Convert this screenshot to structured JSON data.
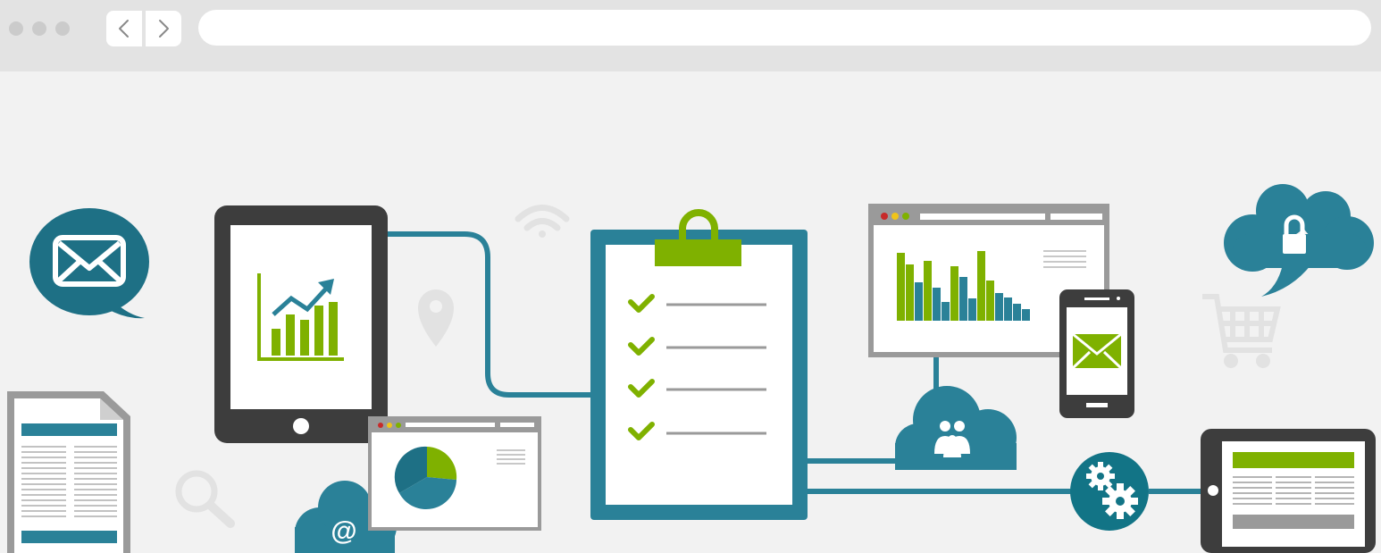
{
  "browser": {
    "url": "",
    "back_icon": "chevron-left-icon",
    "forward_icon": "chevron-right-icon"
  },
  "illustration": {
    "icons": [
      "mail-speech-bubble-icon",
      "newspaper-document-icon",
      "tablet-growth-chart-icon",
      "search-icon",
      "wifi-icon",
      "location-pin-icon",
      "at-sign-cloud-icon",
      "pie-chart-window-icon",
      "checklist-clipboard-icon",
      "bar-chart-window-icon",
      "smartphone-mail-icon",
      "people-cloud-icon",
      "gears-icon",
      "lock-cloud-icon",
      "shopping-cart-icon",
      "tablet-document-icon"
    ],
    "colors": {
      "teal": "#2a8198",
      "dark_teal": "#1e7085",
      "green": "#7fb100",
      "dark_gray": "#3d3d3d",
      "mid_gray": "#9a9a9a",
      "light_gray": "#e0e0e0",
      "background": "#f2f2f2",
      "window_red": "#c72a2a",
      "window_yellow": "#f0c419"
    }
  }
}
